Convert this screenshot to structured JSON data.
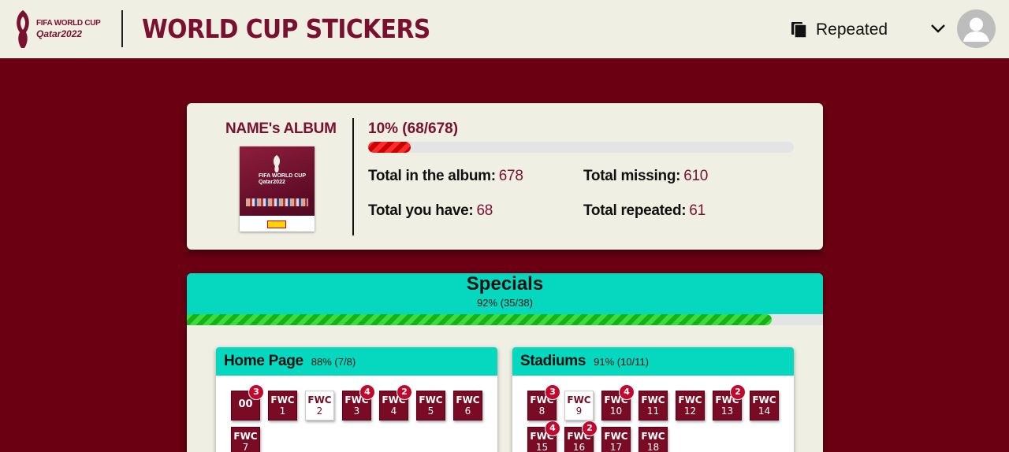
{
  "header": {
    "logo_line1": "FIFA WORLD CUP",
    "logo_line2": "Qatar2022",
    "title": "WORLD CUP STICKERS",
    "filter_label": "Repeated"
  },
  "album": {
    "name": "NAME's ALBUM",
    "cover_line1": "FIFA WORLD CUP",
    "cover_line2": "Qatar2022",
    "progress_text": "10% (68/678)",
    "progress_fraction": 0.1,
    "total_label": "Total in the album:",
    "total_value": "678",
    "have_label": "Total you have:",
    "have_value": "68",
    "missing_label": "Total missing:",
    "missing_value": "610",
    "repeated_label": "Total repeated:",
    "repeated_value": "61"
  },
  "specials": {
    "title": "Specials",
    "progress_text": "92% (35/38)",
    "progress_fraction": 0.92,
    "groups": [
      {
        "title": "Home Page",
        "progress_text": "88% (7/8)",
        "stickers": [
          {
            "top": "00",
            "num": "",
            "have": true,
            "badge": "3"
          },
          {
            "top": "FWC",
            "num": "1",
            "have": true,
            "badge": ""
          },
          {
            "top": "FWC",
            "num": "2",
            "have": false,
            "badge": ""
          },
          {
            "top": "FWC",
            "num": "3",
            "have": true,
            "badge": "4"
          },
          {
            "top": "FWC",
            "num": "4",
            "have": true,
            "badge": "2"
          },
          {
            "top": "FWC",
            "num": "5",
            "have": true,
            "badge": ""
          },
          {
            "top": "FWC",
            "num": "6",
            "have": true,
            "badge": ""
          },
          {
            "top": "FWC",
            "num": "7",
            "have": true,
            "badge": ""
          }
        ]
      },
      {
        "title": "Stadiums",
        "progress_text": "91% (10/11)",
        "stickers": [
          {
            "top": "FWC",
            "num": "8",
            "have": true,
            "badge": "3"
          },
          {
            "top": "FWC",
            "num": "9",
            "have": false,
            "badge": ""
          },
          {
            "top": "FWC",
            "num": "10",
            "have": true,
            "badge": "4"
          },
          {
            "top": "FWC",
            "num": "11",
            "have": true,
            "badge": ""
          },
          {
            "top": "FWC",
            "num": "12",
            "have": true,
            "badge": ""
          },
          {
            "top": "FWC",
            "num": "13",
            "have": true,
            "badge": "2"
          },
          {
            "top": "FWC",
            "num": "14",
            "have": true,
            "badge": ""
          },
          {
            "top": "FWC",
            "num": "15",
            "have": true,
            "badge": "4"
          },
          {
            "top": "FWC",
            "num": "16",
            "have": true,
            "badge": "2"
          },
          {
            "top": "FWC",
            "num": "17",
            "have": true,
            "badge": ""
          },
          {
            "top": "FWC",
            "num": "18",
            "have": true,
            "badge": ""
          }
        ]
      }
    ]
  }
}
